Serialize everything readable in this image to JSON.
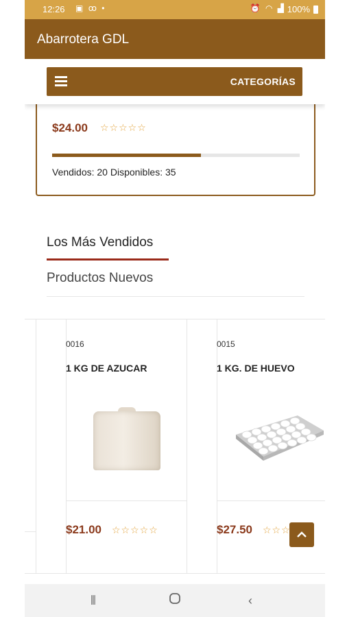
{
  "status_bar": {
    "time": "12:26",
    "battery": "100%",
    "icons_left": [
      "image-icon",
      "voicemail-icon",
      "dot-icon"
    ],
    "icons_right": [
      "alarm-icon",
      "wifi-icon",
      "signal-icon",
      "battery-icon"
    ]
  },
  "app_bar": {
    "title": "Abarrotera GDL"
  },
  "category_bar": {
    "label": "CATEGORÍAS",
    "icon": "menu-icon"
  },
  "featured": {
    "price": "$24.00",
    "rating": 0,
    "sold_progress": 0.6,
    "sold_text": "Vendidos: 20 Disponibles: 35"
  },
  "tabs": [
    {
      "label": "Los Más Vendidos",
      "active": true
    },
    {
      "label": "Productos Nuevos",
      "active": false
    }
  ],
  "products": [
    {
      "code": "0016",
      "name": "1 KG DE AZUCAR",
      "price": "$21.00",
      "rating": 0,
      "image": "sugar-bag"
    },
    {
      "code": "0015",
      "name": "1 KG. DE HUEVO",
      "price": "$27.50",
      "rating": 0,
      "image": "egg-tray"
    }
  ],
  "colors": {
    "status_bar": "#d7a447",
    "brand": "#8b5a1c",
    "price": "#8b3a1c",
    "star": "#e2a33c",
    "tab_underline": "#9a2a1a"
  },
  "stars_glyph": "☆☆☆☆☆"
}
